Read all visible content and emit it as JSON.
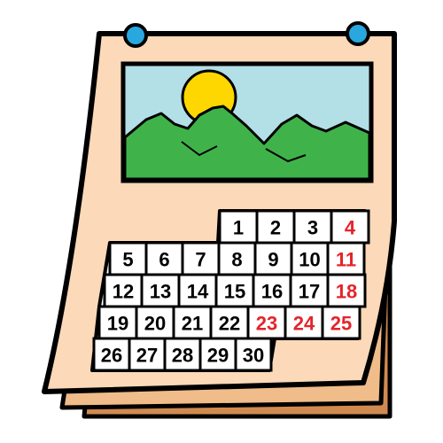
{
  "colors": {
    "page": "#fcd9b8",
    "under_page_1": "#f0bc8a",
    "under_page_2": "#d08a50",
    "sky": "#b3dfe7",
    "sun": "#ffd700",
    "mountain": "#3fb34a",
    "pin": "#29a8e0",
    "ink": "#000000",
    "weekend": "#e3252b",
    "cell": "#ffffff"
  },
  "icons": {
    "left_pin": "pin-icon",
    "right_pin": "pin-icon",
    "picture": "mountain-landscape-picture"
  },
  "calendar": {
    "rows": [
      [
        {
          "label": "1"
        },
        {
          "label": "2"
        },
        {
          "label": "3"
        },
        {
          "label": "4",
          "red": true
        }
      ],
      [
        {
          "label": "5"
        },
        {
          "label": "6"
        },
        {
          "label": "7"
        },
        {
          "label": "8"
        },
        {
          "label": "9"
        },
        {
          "label": "10"
        },
        {
          "label": "11",
          "red": true
        }
      ],
      [
        {
          "label": "12"
        },
        {
          "label": "13"
        },
        {
          "label": "14"
        },
        {
          "label": "15"
        },
        {
          "label": "16"
        },
        {
          "label": "17"
        },
        {
          "label": "18",
          "red": true
        }
      ],
      [
        {
          "label": "19"
        },
        {
          "label": "20"
        },
        {
          "label": "21"
        },
        {
          "label": "22"
        },
        {
          "label": "23",
          "red": true
        },
        {
          "label": "24",
          "red": true
        },
        {
          "label": "25",
          "red": true
        }
      ],
      [
        {
          "label": "26"
        },
        {
          "label": "27"
        },
        {
          "label": "28"
        },
        {
          "label": "29"
        },
        {
          "label": "30"
        }
      ]
    ]
  }
}
